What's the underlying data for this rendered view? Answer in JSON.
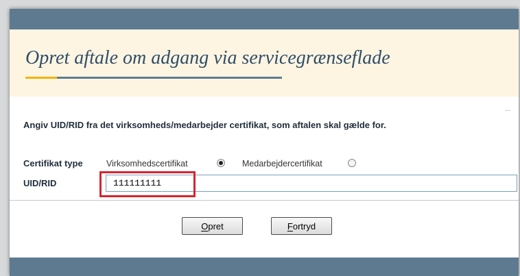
{
  "header": {
    "title": "Opret aftale om adgang via servicegrænseflade",
    "accent_color": "#f2b400",
    "bar_color": "#5d7a91",
    "band_color": "#fdf5e1"
  },
  "more_indicator": "...",
  "form": {
    "instruction": "Angiv UID/RID fra det virksomheds/medarbejder certifikat, som aftalen skal gælde for.",
    "certificate_type": {
      "label": "Certifikat type",
      "options": [
        {
          "label": "Virksomhedscertifikat",
          "selected": true
        },
        {
          "label": "Medarbejdercertifikat",
          "selected": false
        }
      ]
    },
    "uid_rid": {
      "label": "UID/RID",
      "value": "111111111"
    },
    "highlight_color": "#d9232e"
  },
  "buttons": {
    "create": {
      "mnemonic": "O",
      "rest": "pret"
    },
    "cancel": {
      "mnemonic": "F",
      "rest": "ortryd"
    }
  }
}
